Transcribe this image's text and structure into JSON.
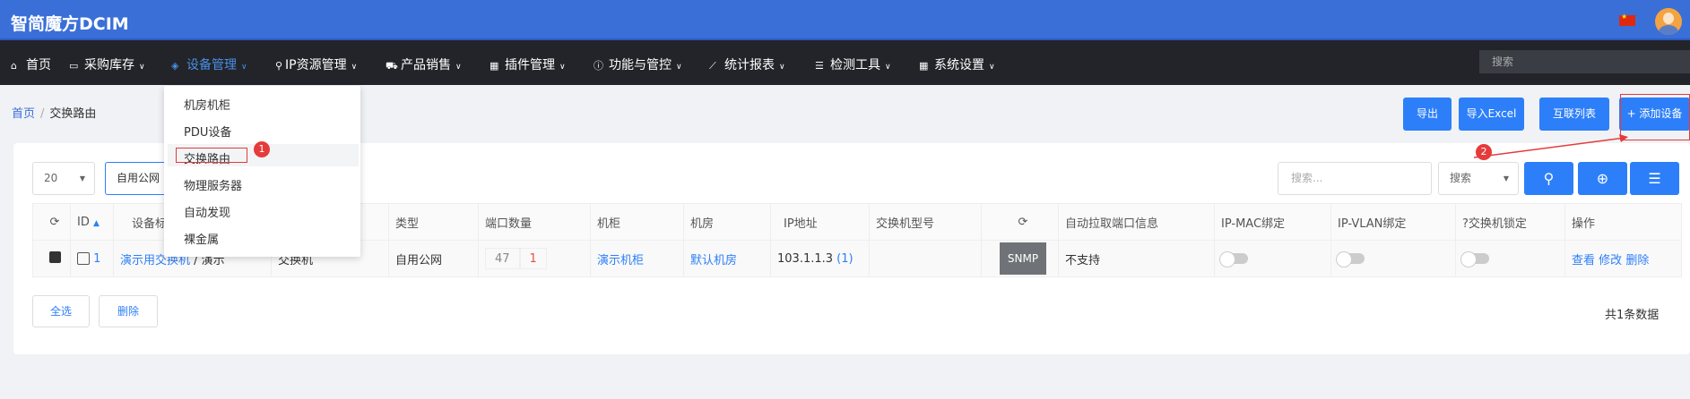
{
  "header": {
    "brand": "智简魔方DCIM"
  },
  "nav": {
    "items": [
      {
        "label": "首页"
      },
      {
        "label": "采购库存"
      },
      {
        "label": "设备管理"
      },
      {
        "label": "IP资源管理"
      },
      {
        "label": "产品销售"
      },
      {
        "label": "插件管理"
      },
      {
        "label": "功能与管控"
      },
      {
        "label": "统计报表"
      },
      {
        "label": "检测工具"
      },
      {
        "label": "系统设置"
      }
    ],
    "search_placeholder": "搜索"
  },
  "dropdown": {
    "items": [
      "机房机柜",
      "PDU设备",
      "交换路由",
      "物理服务器",
      "自动发现",
      "裸金属"
    ]
  },
  "breadcrumb": {
    "home": "首页",
    "sep": "/",
    "current": "交换路由"
  },
  "actions": {
    "export": "导出",
    "import_excel": "导入Excel",
    "interconnect": "互联列表",
    "add_device": "+ 添加设备"
  },
  "filters": {
    "page_size": "20",
    "type_select": "自用公网",
    "search_placeholder": "搜索...",
    "search_field": "搜索"
  },
  "table": {
    "headers": [
      "",
      "ID",
      "设备标",
      "",
      "类型",
      "端口数量",
      "机柜",
      "机房",
      "IP地址",
      "交换机型号",
      "",
      "自动拉取端口信息",
      "IP-MAC绑定",
      "IP-VLAN绑定",
      "交换机锁定",
      "操作"
    ],
    "row": {
      "id": "1",
      "name": "演示用交换机",
      "name_suffix": "/ 演示",
      "kind": "交换机",
      "type": "自用公网",
      "ports_total": "47",
      "ports_used": "1",
      "cabinet": "演示机柜",
      "room": "默认机房",
      "ip": "103.1.1.3",
      "ip_count": "(1)",
      "model": "",
      "protocol": "SNMP",
      "auto_pull": "不支持",
      "ops": [
        "查看",
        "修改",
        "删除"
      ]
    }
  },
  "footer": {
    "select_all": "全选",
    "delete": "删除",
    "total": "共1条数据"
  },
  "annotations": {
    "one": "1",
    "two": "2"
  }
}
